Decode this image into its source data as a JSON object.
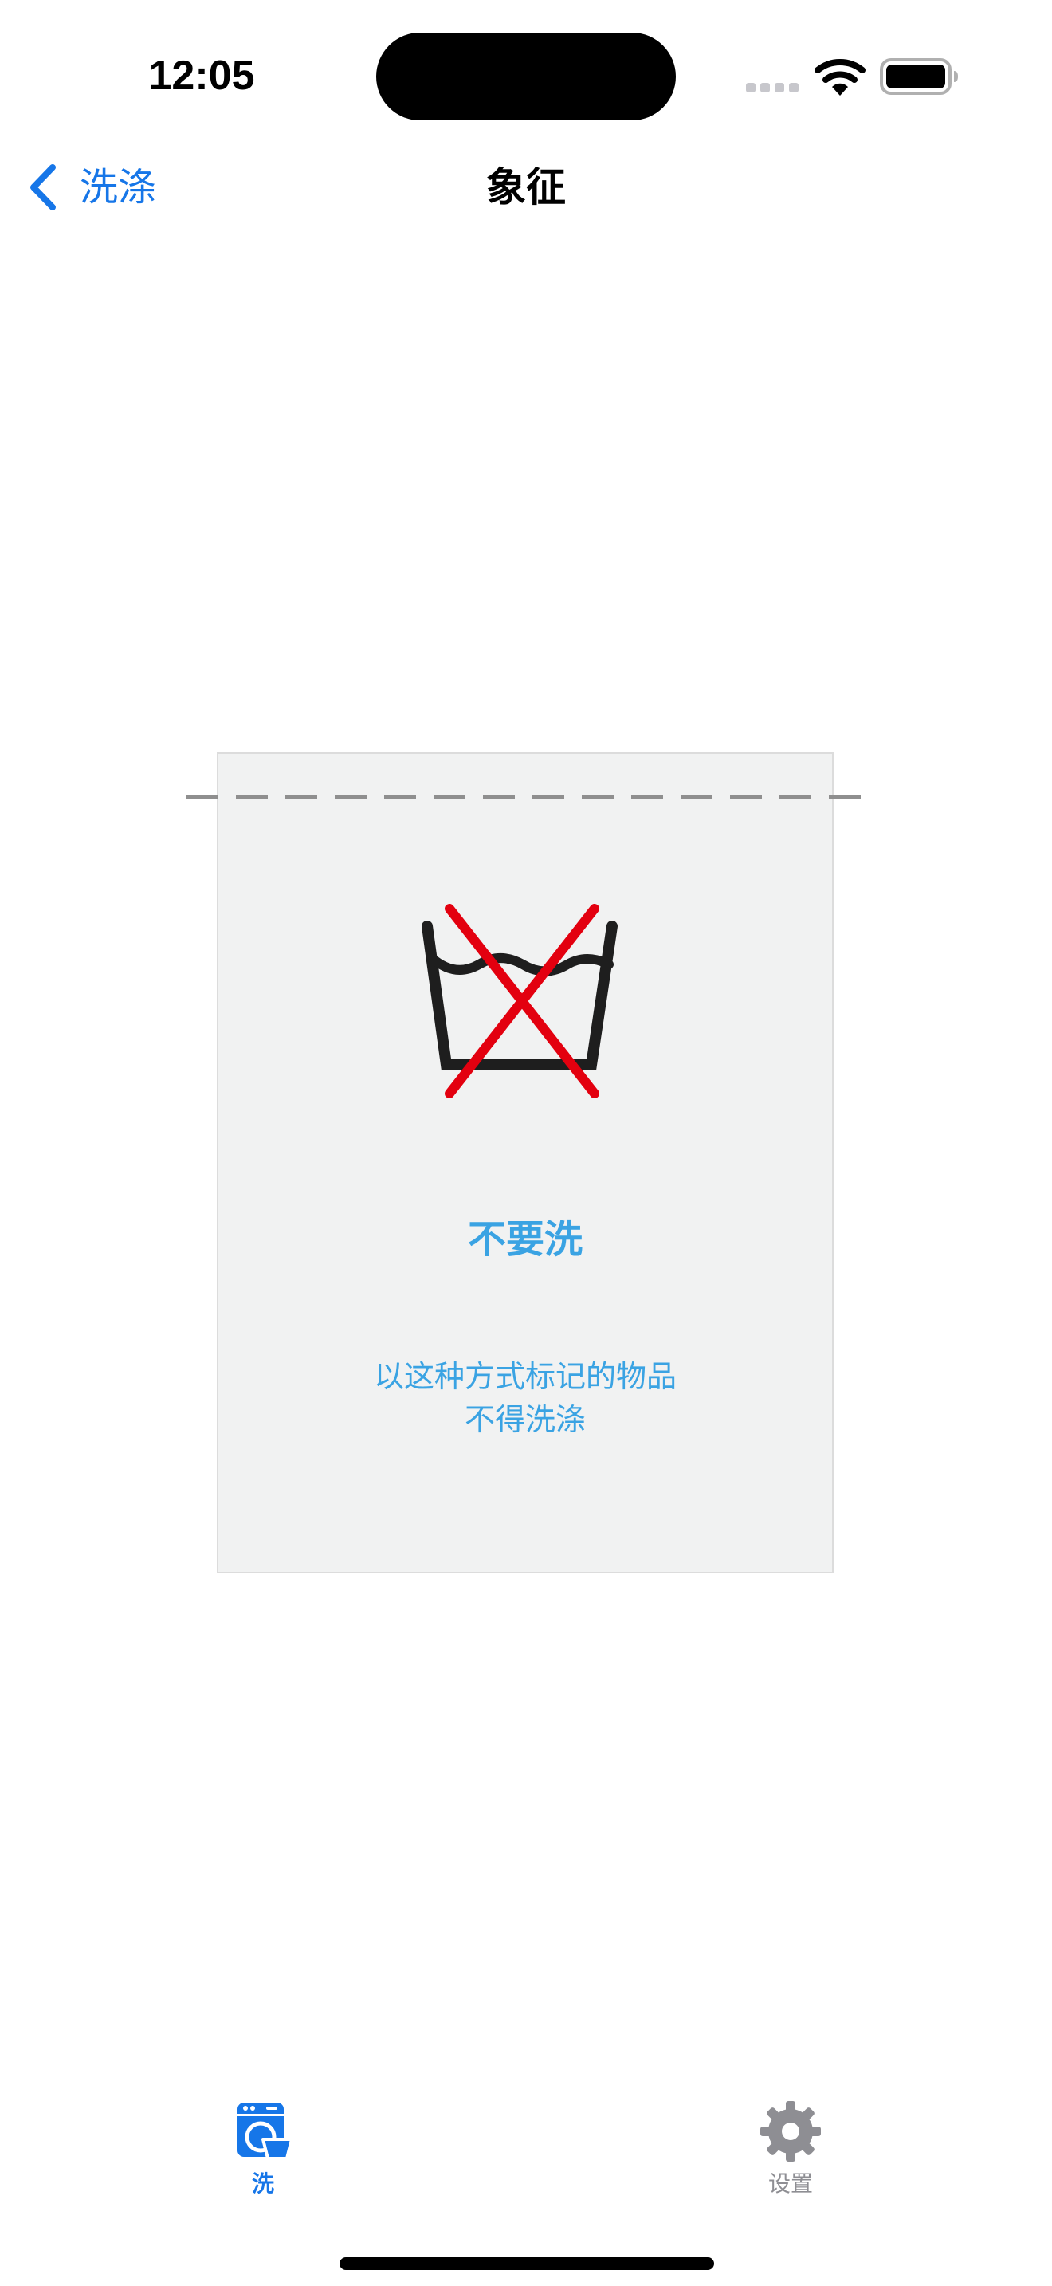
{
  "status_bar": {
    "time": "12:05"
  },
  "nav": {
    "back_label": "洗涤",
    "title": "象征"
  },
  "care_label": {
    "symbol_icon": "do-not-wash-icon",
    "title": "不要洗",
    "description_line1": "以这种方式标记的物品",
    "description_line2": "不得洗涤"
  },
  "tabs": [
    {
      "label": "洗",
      "icon": "washing-machine-icon",
      "selected": true
    },
    {
      "label": "设置",
      "icon": "gear-icon",
      "selected": false
    }
  ],
  "colors": {
    "accent": "#1676e8",
    "label_text": "#3aa3e3",
    "cross_red": "#e3000f",
    "card_background": "#f1f2f2",
    "inactive_tab": "#8e8e93"
  }
}
